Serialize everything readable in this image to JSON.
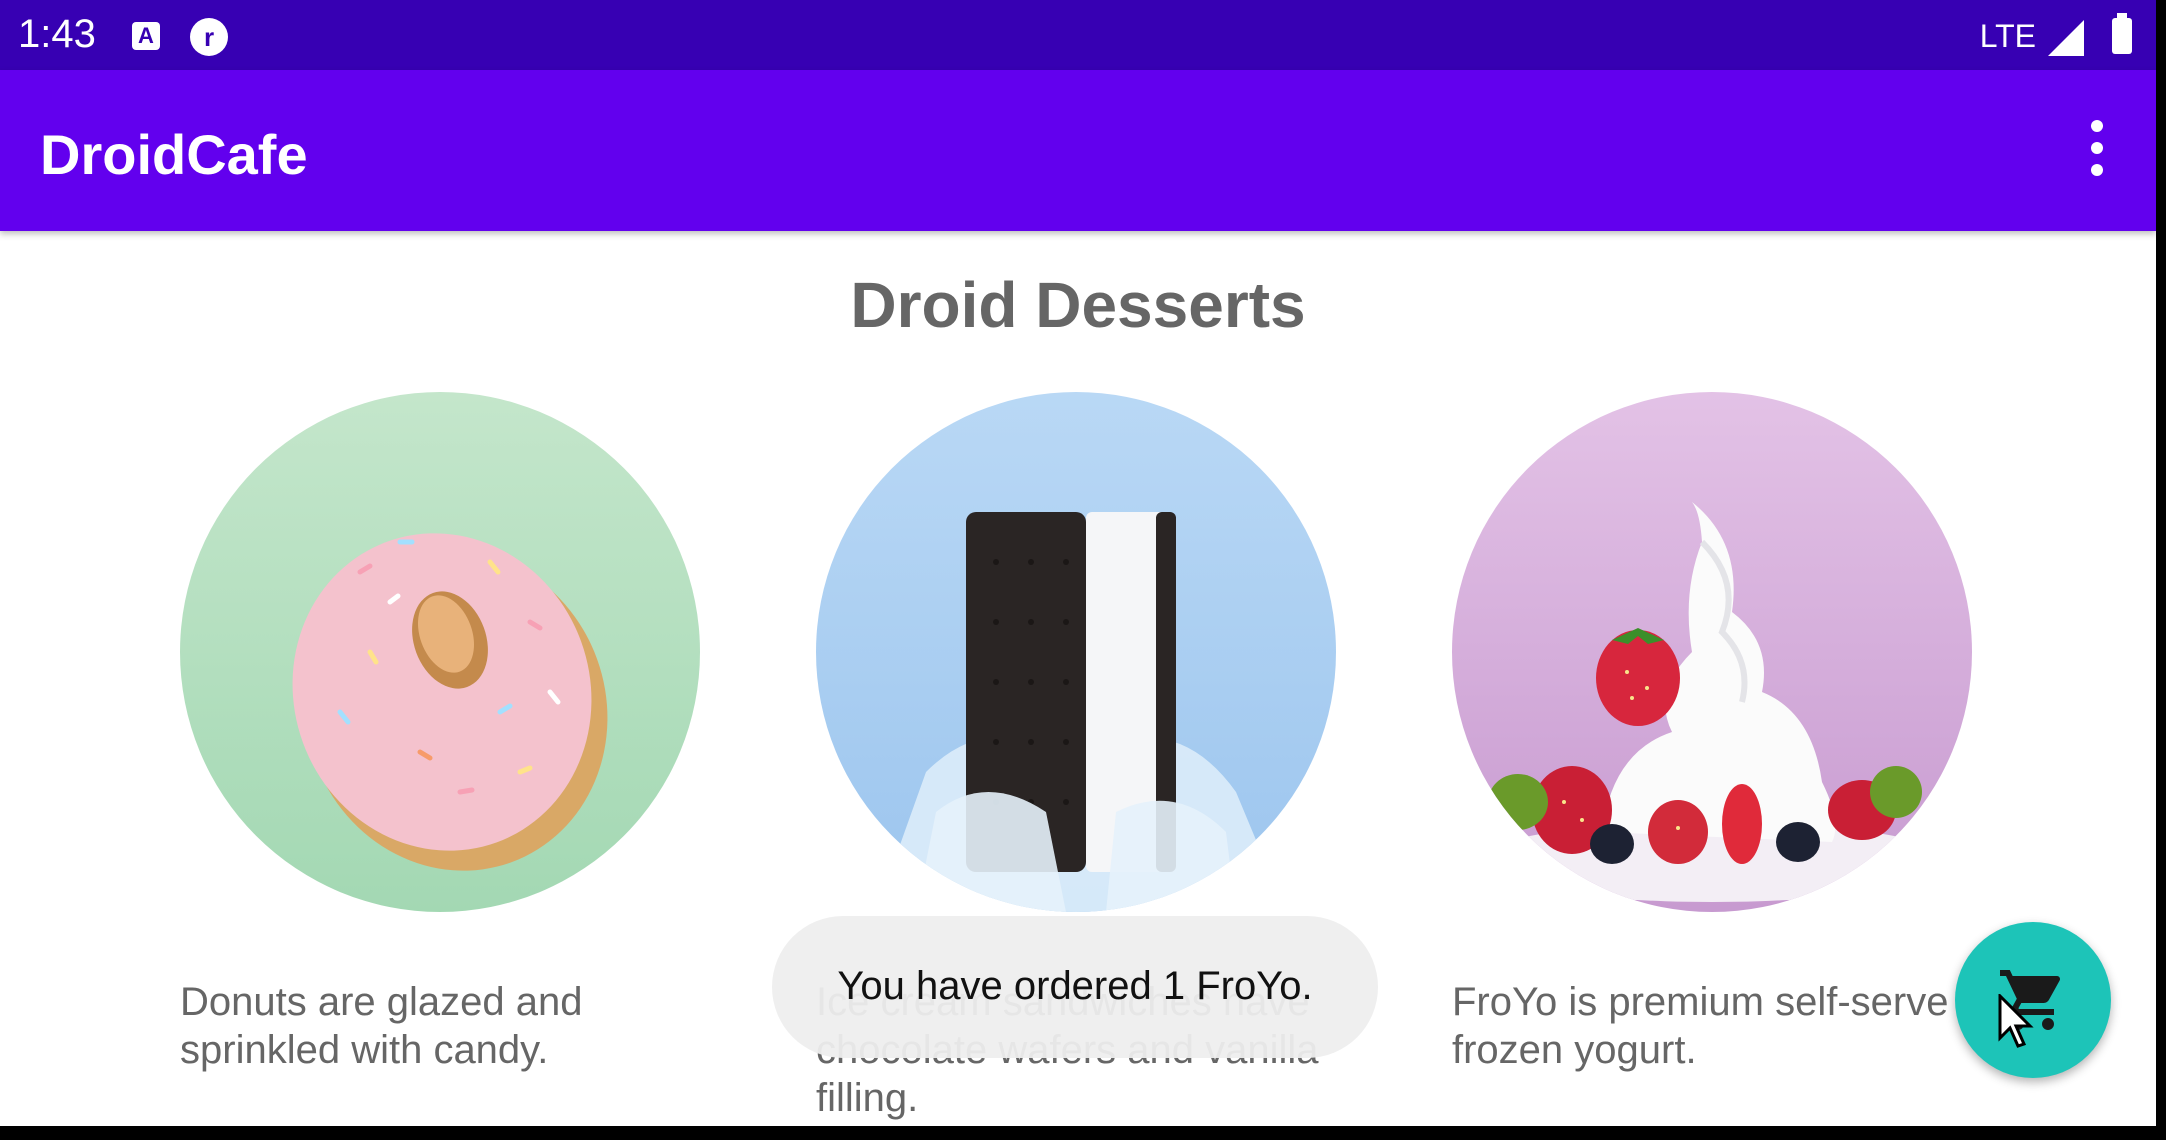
{
  "status_bar": {
    "time": "1:43",
    "a_icon_letter": "A",
    "network": "LTE",
    "icons": [
      "a-notification-icon",
      "r-notification-icon",
      "lte-signal-icon",
      "battery-icon"
    ]
  },
  "app_bar": {
    "title": "DroidCafe",
    "menu_icon": "overflow-menu-icon"
  },
  "main": {
    "title": "Droid Desserts",
    "items": [
      {
        "name": "donut",
        "description": "Donuts are glazed and sprinkled with candy."
      },
      {
        "name": "ice-cream-sandwich",
        "description": "Ice cream sandwiches have chocolate wafers and vanilla filling."
      },
      {
        "name": "froyo",
        "description": "FroYo is premium self-serve frozen yogurt."
      }
    ]
  },
  "toast": {
    "message": "You have ordered 1 FroYo."
  },
  "fab": {
    "icon": "shopping-cart-icon"
  },
  "colors": {
    "status_bar": "#3700b3",
    "app_bar": "#6200ee",
    "fab": "#1dc4b8",
    "text_gray": "#666666"
  }
}
